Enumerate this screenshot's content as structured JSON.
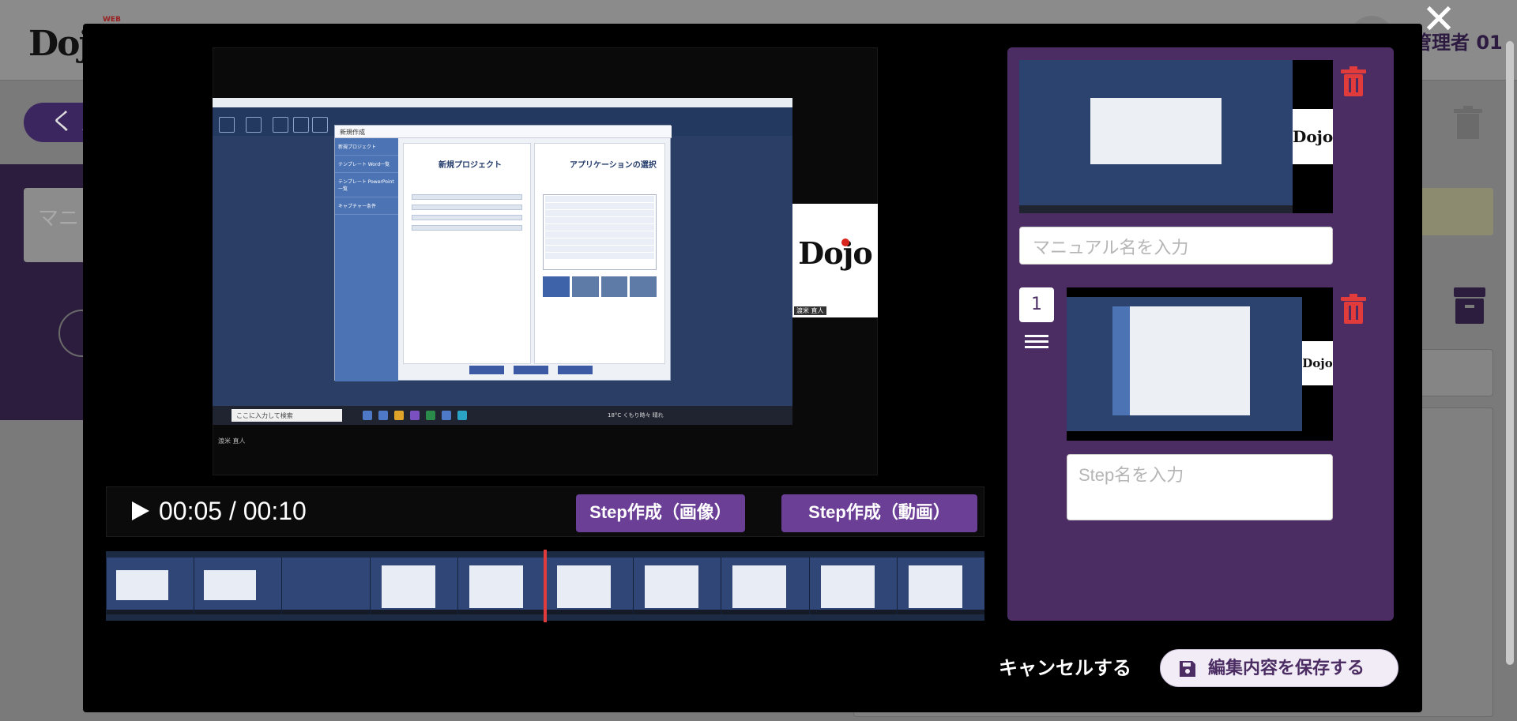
{
  "background": {
    "logo_text": "Dojo",
    "logo_badge": "WEB",
    "user_label": "管理者 01",
    "back_label": "く 戻",
    "card_hint": "マニ"
  },
  "modal": {
    "close_glyph": "✕",
    "player": {
      "time_current": "00:05",
      "time_separator": "/",
      "time_total": "00:10",
      "progress_fraction": 0.5,
      "step_image_label": "Step作成（画像）",
      "step_video_label": "Step作成（動画）"
    },
    "video_screen": {
      "dialog_title": "新規作成",
      "pane1_title": "新規プロジェクト",
      "pane2_title": "アプリケーションの選択",
      "left_menu": [
        "新規プロジェクト",
        "テンプレート Word一覧",
        "テンプレート PowerPoint一覧",
        "キャプチャー条件"
      ],
      "taskbar_search": "ここに入力して検索",
      "tray_text": "18°C くもり時々 晴れ",
      "dojo_caption": "渡米 直人",
      "frame_caption": "渡米 直人"
    },
    "timeline_frames": 10,
    "side_panel": {
      "manual_placeholder": "マニュアル名を入力",
      "step_number": "1",
      "step_placeholder": "Step名を入力",
      "thumb_logo": "Dojo"
    },
    "footer": {
      "cancel_label": "キャンセルする",
      "save_label": "編集内容を保存する"
    }
  },
  "colors": {
    "accent_purple": "#6b3f96",
    "panel_purple": "#4c2d63",
    "delete_red": "#e23b3b",
    "playhead_red": "#e23b3b"
  }
}
